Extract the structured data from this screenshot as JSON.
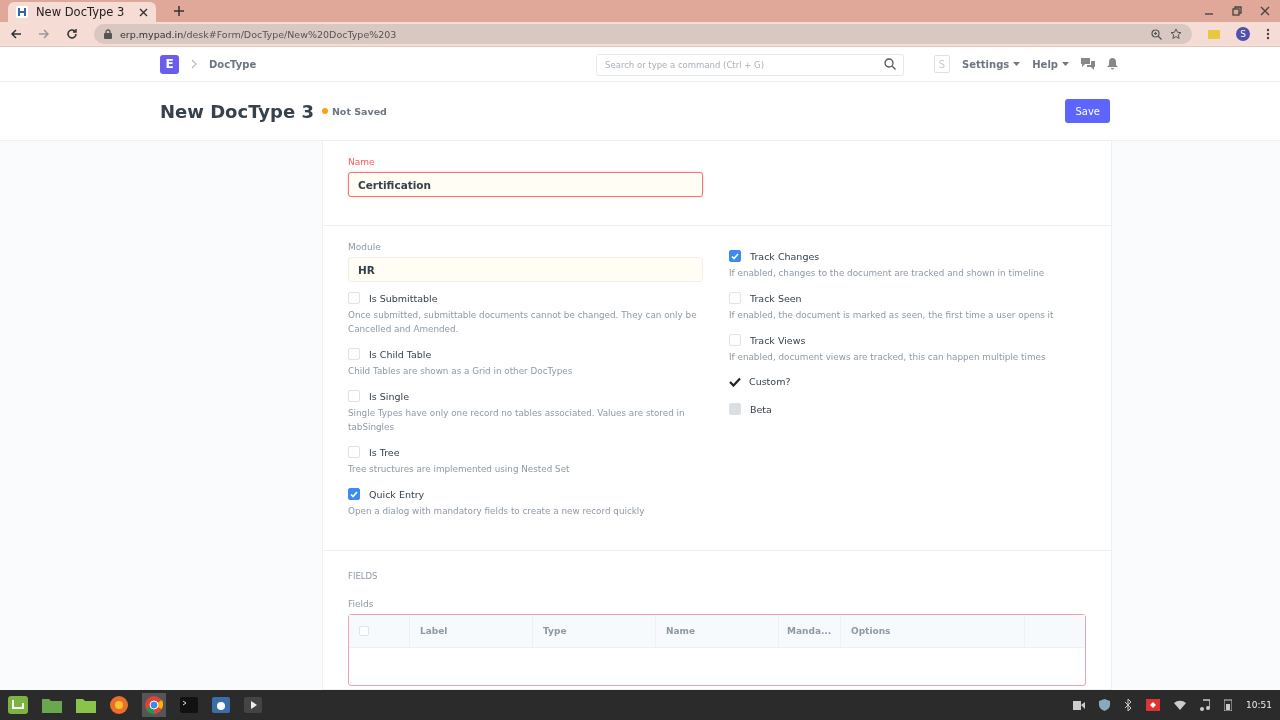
{
  "browser": {
    "tab": {
      "title": "New DocType 3"
    },
    "url_host": "erp.mypad.in",
    "url_path": "/desk#Form/DocType/New%20DocType%203",
    "avatar": "S"
  },
  "navbar": {
    "logo": "E",
    "breadcrumb": "DocType",
    "search_placeholder": "Search or type a command (Ctrl + G)",
    "user": "S",
    "menus": [
      "Settings",
      "Help"
    ]
  },
  "page": {
    "title": "New DocType 3",
    "indicator": {
      "label": "Not Saved",
      "color": "#ffa00a"
    },
    "save": "Save"
  },
  "name_field": {
    "label": "Name",
    "value": "Certification"
  },
  "module_field": {
    "label": "Module",
    "value": "HR"
  },
  "left_checks": [
    {
      "kind": "checkbox",
      "label": "Is Submittable",
      "checked": false,
      "description": "Once submitted, submittable documents cannot be changed. They can only be Cancelled and Amended."
    },
    {
      "kind": "checkbox",
      "label": "Is Child Table",
      "checked": false,
      "description": "Child Tables are shown as a Grid in other DocTypes"
    },
    {
      "kind": "checkbox",
      "label": "Is Single",
      "checked": false,
      "description": "Single Types have only one record no tables associated. Values are stored in tabSingles"
    },
    {
      "kind": "checkbox",
      "label": "Is Tree",
      "checked": false,
      "description": "Tree structures are implemented using Nested Set"
    },
    {
      "kind": "checkbox",
      "label": "Quick Entry",
      "checked": true,
      "description": "Open a dialog with mandatory fields to create a new record quickly"
    }
  ],
  "right_checks": [
    {
      "kind": "checkbox",
      "label": "Track Changes",
      "checked": true,
      "disabled": false,
      "description": "If enabled, changes to the document are tracked and shown in timeline"
    },
    {
      "kind": "checkbox",
      "label": "Track Seen",
      "checked": false,
      "disabled": false,
      "description": "If enabled, the document is marked as seen, the first time a user opens it"
    },
    {
      "kind": "checkbox",
      "label": "Track Views",
      "checked": false,
      "disabled": false,
      "description": "If enabled, document views are tracked, this can happen multiple times"
    },
    {
      "kind": "tick",
      "label": "Custom?",
      "checked": true
    },
    {
      "kind": "checkbox",
      "label": "Beta",
      "checked": false,
      "disabled": true
    }
  ],
  "fields_section": {
    "heading": "FIELDS",
    "label": "Fields",
    "select_all_checked": false,
    "columns": [
      "Label",
      "Type",
      "Name",
      "Manda...",
      "Options"
    ]
  },
  "taskbar": {
    "time": "10:51"
  }
}
